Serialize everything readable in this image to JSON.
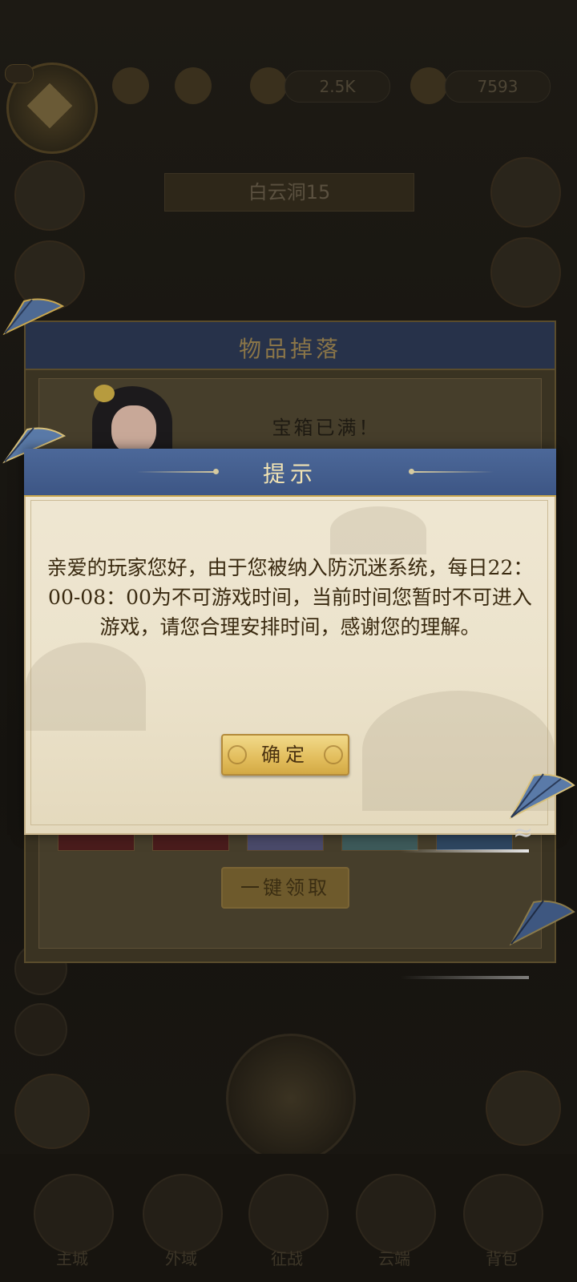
{
  "top_bar": {
    "level_badge": "",
    "resource_1": "2.5K",
    "resource_2": "7593"
  },
  "stage": {
    "label": "白云洞15"
  },
  "drop_panel": {
    "title": "物品掉落",
    "message": "宝箱已满！",
    "claim_all_label": "一键领取"
  },
  "dialog": {
    "title": "提示",
    "message": "亲爱的玩家您好，由于您被纳入防沉迷系统，每日22：00-08：00为不可游戏时间，当前时间您暂时不可进入游戏，请您合理安排时间，感谢您的理解。",
    "confirm_label": "确定"
  },
  "bottom_nav": {
    "items": [
      "主城",
      "外域",
      "征战",
      "云端",
      "背包"
    ]
  },
  "colors": {
    "dialog_header": "#4c6899",
    "dialog_body": "#efe7d3",
    "button_gold": "#e2bd5c",
    "text_dark": "#3a2a10"
  },
  "icons": [
    "avatar",
    "fan-icon",
    "chest-icon",
    "swirl-icon"
  ]
}
